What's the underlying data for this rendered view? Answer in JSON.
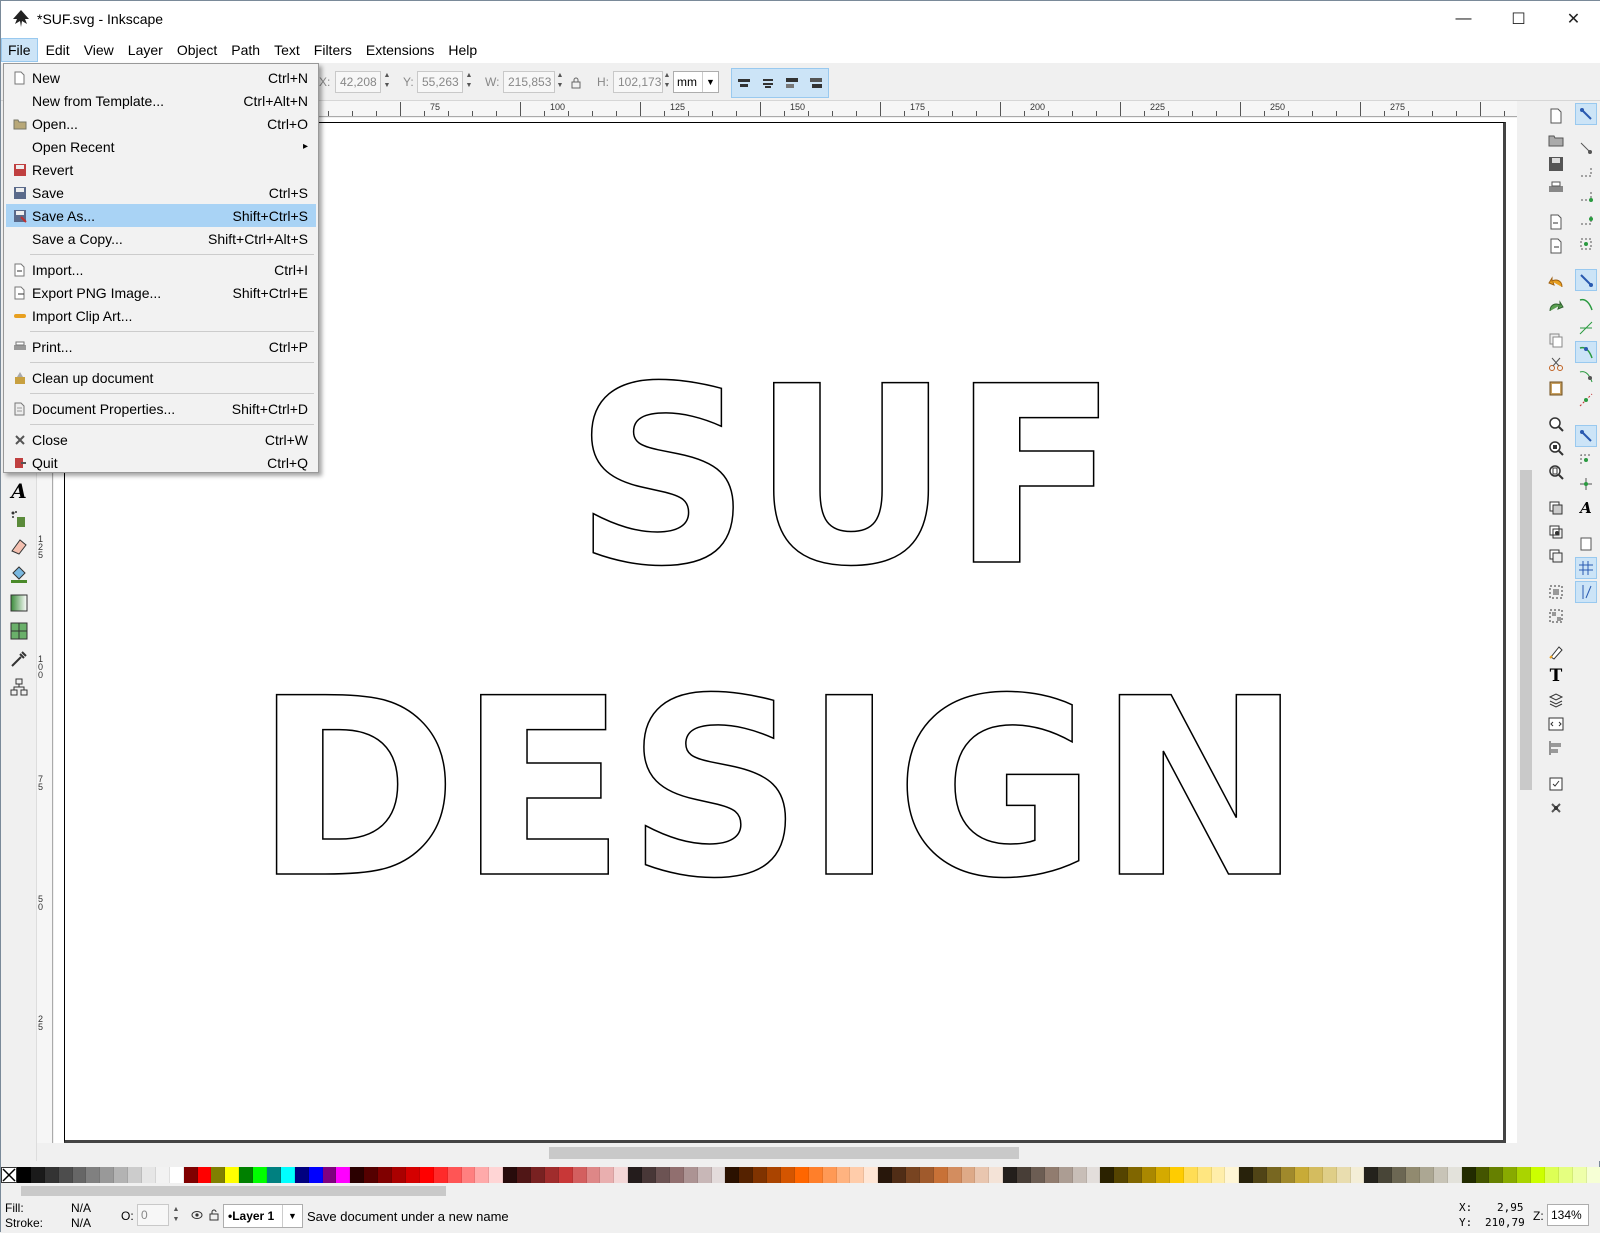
{
  "window": {
    "title": "*SUF.svg - Inkscape",
    "controls": {
      "minimize": "—",
      "maximize": "☐",
      "close": "✕"
    }
  },
  "menubar": {
    "items": [
      {
        "label": "File",
        "active": true
      },
      {
        "label": "Edit"
      },
      {
        "label": "View"
      },
      {
        "label": "Layer"
      },
      {
        "label": "Object"
      },
      {
        "label": "Path"
      },
      {
        "label": "Text"
      },
      {
        "label": "Filters"
      },
      {
        "label": "Extensions"
      },
      {
        "label": "Help"
      }
    ]
  },
  "toolctrl": {
    "x_label": "X:",
    "x_value": "42,208",
    "y_label": "Y:",
    "y_value": "55,263",
    "w_label": "W:",
    "w_value": "215,853",
    "h_label": "H:",
    "h_value": "102,173",
    "unit": "mm"
  },
  "file_menu": {
    "items": [
      {
        "label": "New",
        "shortcut": "Ctrl+N",
        "icon": "new-document-icon"
      },
      {
        "label": "New from Template...",
        "shortcut": "Ctrl+Alt+N",
        "icon": ""
      },
      {
        "label": "Open...",
        "shortcut": "Ctrl+O",
        "icon": "open-folder-icon"
      },
      {
        "label": "Open Recent",
        "shortcut": "",
        "icon": "",
        "submenu": "▸"
      },
      {
        "label": "Revert",
        "shortcut": "",
        "icon": "revert-icon"
      },
      {
        "label": "Save",
        "shortcut": "Ctrl+S",
        "icon": "save-icon"
      },
      {
        "label": "Save As...",
        "shortcut": "Shift+Ctrl+S",
        "icon": "save-as-icon",
        "highlighted": true
      },
      {
        "label": "Save a Copy...",
        "shortcut": "Shift+Ctrl+Alt+S",
        "icon": ""
      },
      {
        "label": "Import...",
        "shortcut": "Ctrl+I",
        "icon": "import-icon"
      },
      {
        "label": "Export PNG Image...",
        "shortcut": "Shift+Ctrl+E",
        "icon": "export-icon"
      },
      {
        "label": "Import Clip Art...",
        "shortcut": "",
        "icon": "clip-art-icon"
      },
      {
        "label": "Print...",
        "shortcut": "Ctrl+P",
        "icon": "print-icon"
      },
      {
        "label": "Clean up document",
        "shortcut": "",
        "icon": "clean-up-icon"
      },
      {
        "label": "Document Properties...",
        "shortcut": "Shift+Ctrl+D",
        "icon": "document-properties-icon"
      },
      {
        "label": "Close",
        "shortcut": "Ctrl+W",
        "icon": "close-document-icon"
      },
      {
        "label": "Quit",
        "shortcut": "Ctrl+Q",
        "icon": "quit-icon"
      }
    ]
  },
  "ruler": {
    "top_labels": [
      "75",
      "100",
      "125",
      "150",
      "175",
      "200",
      "225",
      "250",
      "275"
    ],
    "left_labels": [
      "125",
      "100",
      "75",
      "50",
      "25"
    ]
  },
  "canvas_text": {
    "line1": "SUF",
    "line2": "DESIGN"
  },
  "status": {
    "fill_label": "Fill:",
    "fill_value": "N/A",
    "stroke_label": "Stroke:",
    "stroke_value": "N/A",
    "opacity_label": "O:",
    "opacity_value": "0",
    "layer": "•Layer 1",
    "message": "Save document under a new name",
    "x_label": "X:",
    "x_value": "2,95",
    "y_label": "Y:",
    "y_value": "210,79",
    "zoom_label": "Z:",
    "zoom_value": "134%"
  },
  "colors": {
    "menu_highlight": "#a9d3f5",
    "accent": "#cce4f7"
  },
  "palette": [
    "#000000",
    "#1a1a1a",
    "#333333",
    "#4d4d4d",
    "#666666",
    "#808080",
    "#999999",
    "#b3b3b3",
    "#cccccc",
    "#e6e6e6",
    "#f2f2f2",
    "#ffffff",
    "#800000",
    "#ff0000",
    "#808000",
    "#ffff00",
    "#008000",
    "#00ff00",
    "#008080",
    "#00ffff",
    "#000080",
    "#0000ff",
    "#800080",
    "#ff00ff",
    "#2b0000",
    "#550000",
    "#800000",
    "#aa0000",
    "#d40000",
    "#ff0000",
    "#ff2a2a",
    "#ff5555",
    "#ff8080",
    "#ffaaaa",
    "#ffd5d5",
    "#280b0b",
    "#501616",
    "#782121",
    "#a02c2c",
    "#c83737",
    "#d35f5f",
    "#de8787",
    "#e9afaf",
    "#f4d7d7",
    "#241c1c",
    "#483737",
    "#6c5353",
    "#916f6f",
    "#ac9393",
    "#c8b7b7",
    "#e3dbdb",
    "#2b1100",
    "#552200",
    "#803300",
    "#aa4400",
    "#d45500",
    "#ff6600",
    "#ff7f2a",
    "#ff9955",
    "#ffb380",
    "#ffccaa",
    "#ffe6d5",
    "#28170b",
    "#502d16",
    "#784421",
    "#a05a2c",
    "#c87137",
    "#d38d5f",
    "#deaa87",
    "#e9c6af",
    "#f4e3d7",
    "#241f1c",
    "#483e37",
    "#6c5d53",
    "#917c6f",
    "#ac9d93",
    "#c8beb7",
    "#e3dedb",
    "#2b2200",
    "#554400",
    "#806600",
    "#aa8800",
    "#d4aa00",
    "#ffcc00",
    "#ffdd55",
    "#ffe680",
    "#ffeeaa",
    "#fff6d5",
    "#28220b",
    "#504416",
    "#786721",
    "#a0892c",
    "#c8ab37",
    "#d4bc5f",
    "#dfce87",
    "#e9ddaf",
    "#f4eed7",
    "#24221c",
    "#484537",
    "#6c6753",
    "#918a6f",
    "#aca793",
    "#c8c4b7",
    "#e3e2db",
    "#222b00",
    "#445500",
    "#668000",
    "#88aa00",
    "#aad400",
    "#ccff00",
    "#ddff55",
    "#e5ff80",
    "#eeffaa",
    "#f6ffd5"
  ]
}
